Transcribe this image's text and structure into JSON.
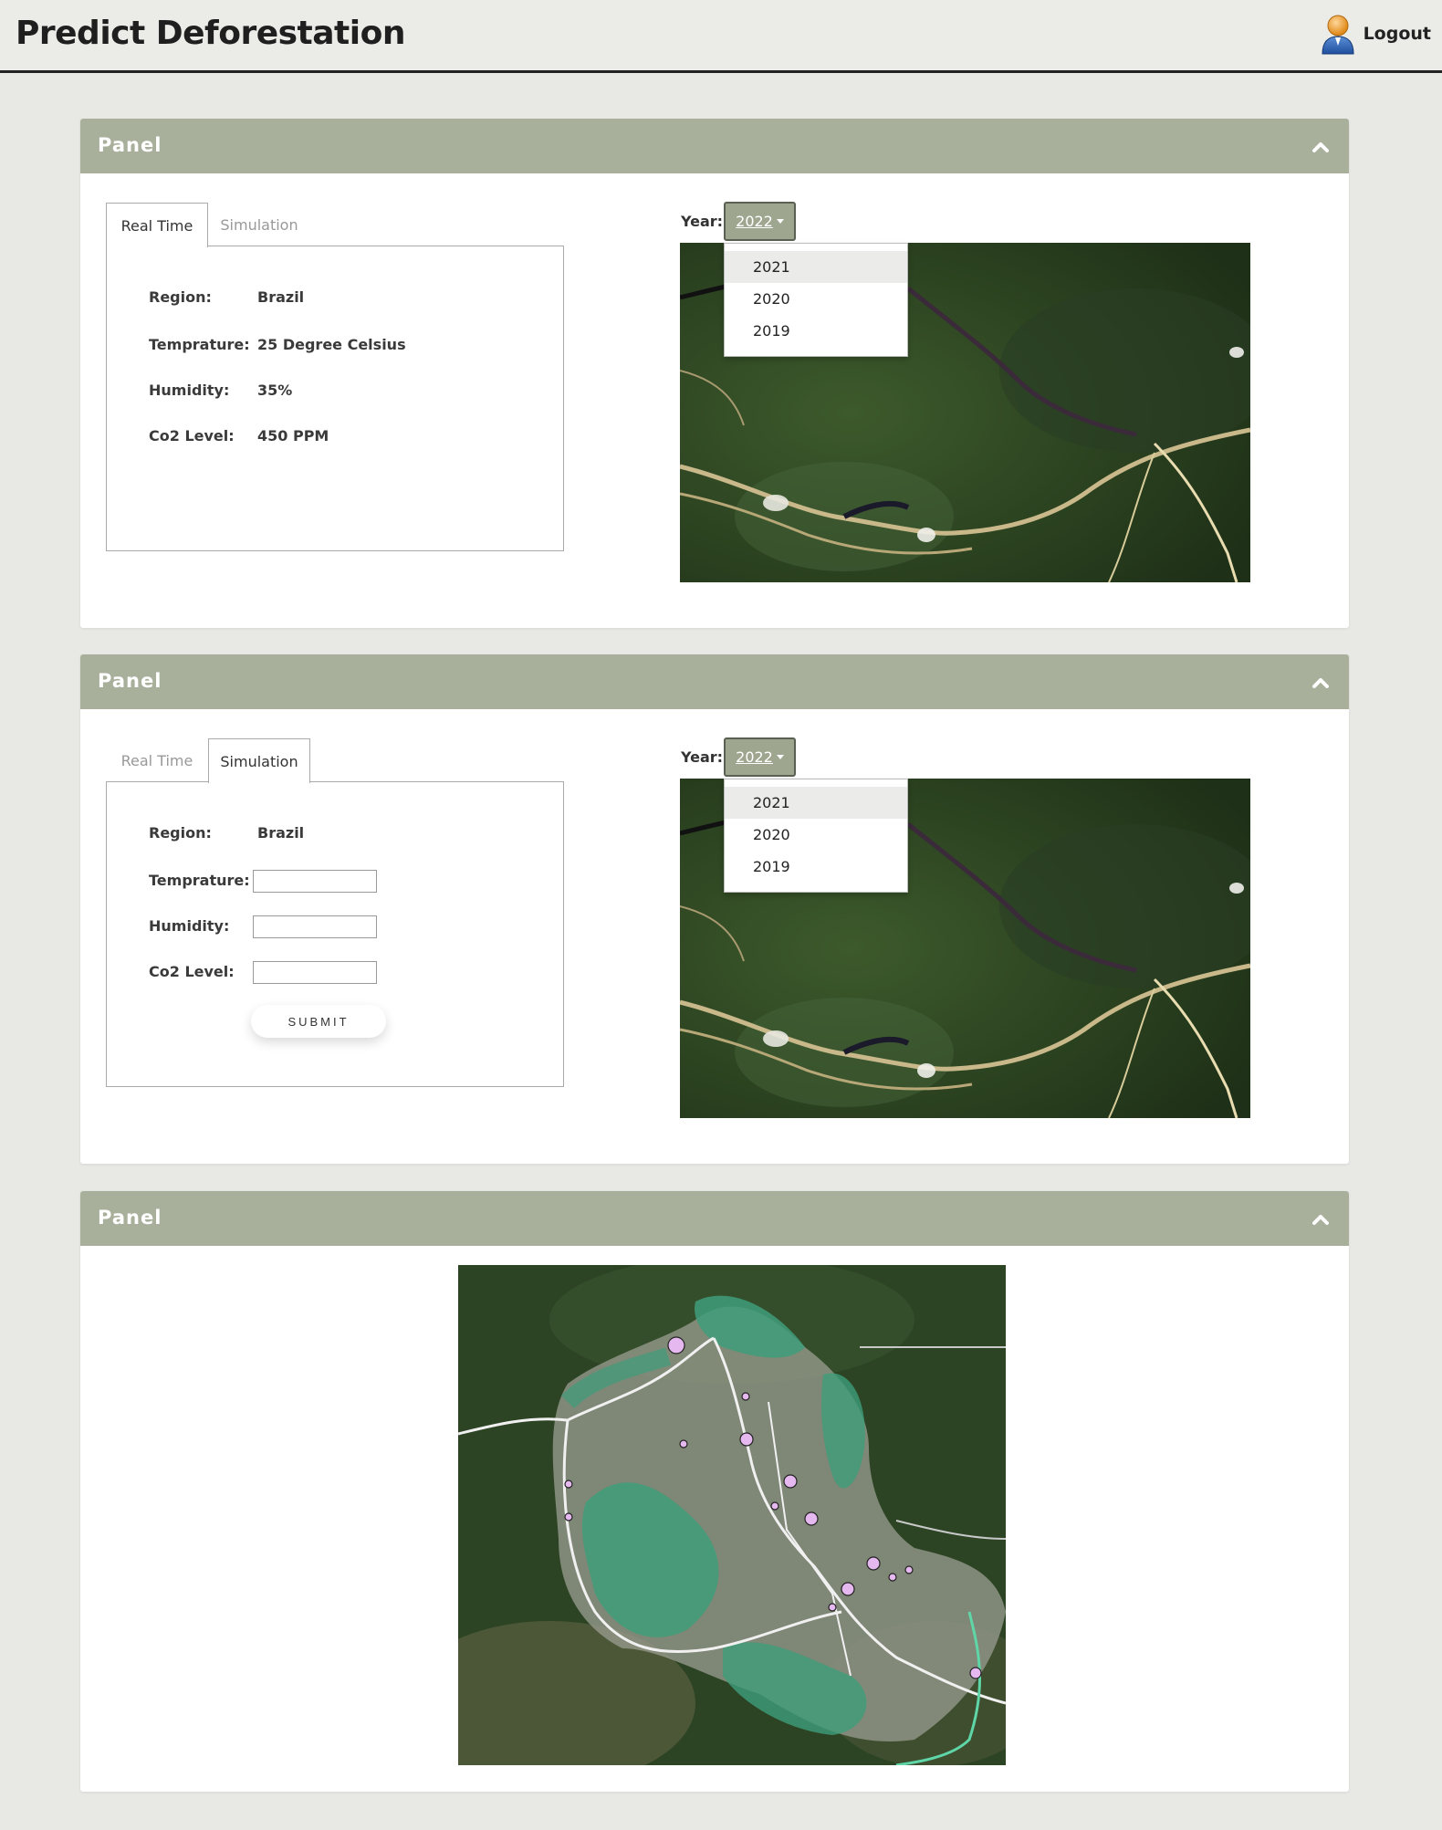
{
  "app": {
    "title": "Predict Deforestation",
    "logout_label": "Logout"
  },
  "icons": {
    "user": "user-avatar-icon",
    "collapse": "chevron-up-icon",
    "caret": "caret-down-icon"
  },
  "colors": {
    "panel_header": "#a8b09c",
    "year_button": "#9ea690",
    "forest": "#2f4a22",
    "deforest_green": "#3f9d7a",
    "marker": "#e6b8f0"
  },
  "panels": [
    {
      "title": "Panel",
      "tabs": [
        "Real Time",
        "Simulation"
      ],
      "active_tab": "Real Time",
      "fields": [
        {
          "label": "Region:",
          "value": "Brazil"
        },
        {
          "label": "Temprature:",
          "value": "25 Degree Celsius"
        },
        {
          "label": "Humidity:",
          "value": "35%"
        },
        {
          "label": "Co2 Level:",
          "value": "450 PPM"
        }
      ],
      "year": {
        "label": "Year:",
        "selected": "2022",
        "options": [
          "2021",
          "2020",
          "2019"
        ]
      }
    },
    {
      "title": "Panel",
      "tabs": [
        "Real Time",
        "Simulation"
      ],
      "active_tab": "Simulation",
      "fields": [
        {
          "label": "Region:",
          "value": "Brazil"
        },
        {
          "label": "Temprature:",
          "value": ""
        },
        {
          "label": "Humidity:",
          "value": ""
        },
        {
          "label": "Co2 Level:",
          "value": ""
        }
      ],
      "submit_label": "SUBMIT",
      "year": {
        "label": "Year:",
        "selected": "2022",
        "options": [
          "2021",
          "2020",
          "2019"
        ]
      }
    },
    {
      "title": "Panel"
    }
  ]
}
